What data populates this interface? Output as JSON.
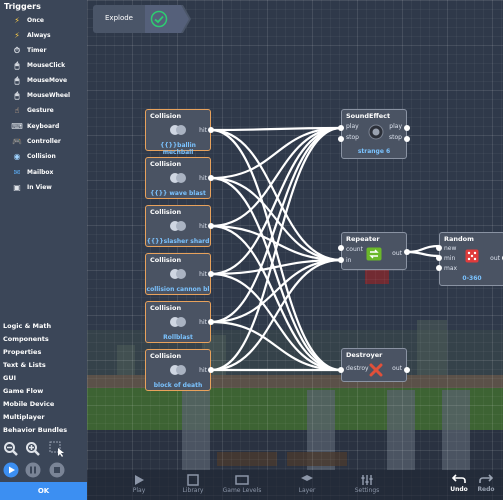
{
  "sidebar": {
    "title": "Triggers",
    "triggers": [
      {
        "label": "Once",
        "icon": "lightning-icon"
      },
      {
        "label": "Always",
        "icon": "lightning-always-icon"
      },
      {
        "label": "Timer",
        "icon": "timer-icon"
      },
      {
        "label": "MouseClick",
        "icon": "mouse-click-icon"
      },
      {
        "label": "MouseMove",
        "icon": "mouse-move-icon"
      },
      {
        "label": "MouseWheel",
        "icon": "mouse-wheel-icon"
      },
      {
        "label": "Gesture",
        "icon": "gesture-icon"
      },
      {
        "label": "Keyboard",
        "icon": "keyboard-icon"
      },
      {
        "label": "Controller",
        "icon": "controller-icon"
      },
      {
        "label": "Collision",
        "icon": "collision-icon"
      },
      {
        "label": "Mailbox",
        "icon": "mailbox-icon"
      },
      {
        "label": "In View",
        "icon": "in-view-icon"
      }
    ],
    "categories": [
      "Logic & Math",
      "Components",
      "Properties",
      "Text & Lists",
      "GUI",
      "Game Flow",
      "Mobile Device",
      "Multiplayer",
      "Behavior Bundles"
    ],
    "ok_label": "OK"
  },
  "breadcrumb": {
    "label": "Explode"
  },
  "nodes": {
    "collisions": [
      {
        "title": "Collision",
        "port": "hit",
        "value": "{{}}ballin mechball"
      },
      {
        "title": "Collision",
        "port": "hit",
        "value": "{{}} wave blast"
      },
      {
        "title": "Collision",
        "port": "hit",
        "value": "{{}}slasher shard"
      },
      {
        "title": "Collision",
        "port": "hit",
        "value": "collision cannon bl"
      },
      {
        "title": "Collision",
        "port": "hit",
        "value": "Rollblast"
      },
      {
        "title": "Collision",
        "port": "hit",
        "value": "block of death"
      }
    ],
    "sound": {
      "title": "SoundEffect",
      "in1": "play",
      "in2": "stop",
      "out1": "play",
      "out2": "stop",
      "value": "strange 6"
    },
    "repeater": {
      "title": "Repeater",
      "in1": "count",
      "in2": "in",
      "out1": "out"
    },
    "random": {
      "title": "Random",
      "in1": "new",
      "in2": "min",
      "in3": "max",
      "out1": "out",
      "value": "0-360"
    },
    "destroyer": {
      "title": "Destroyer",
      "in1": "destroy",
      "out1": "out"
    }
  },
  "bottom_bar": {
    "items": [
      "Play",
      "Library",
      "Game Levels",
      "Layer",
      "Settings"
    ],
    "undo": "Undo",
    "redo": "Redo"
  },
  "colors": {
    "accent": "#3c8ff2",
    "selected_border": "#e8a25c",
    "value_text": "#7bc3ff",
    "check": "#2ecc71"
  }
}
